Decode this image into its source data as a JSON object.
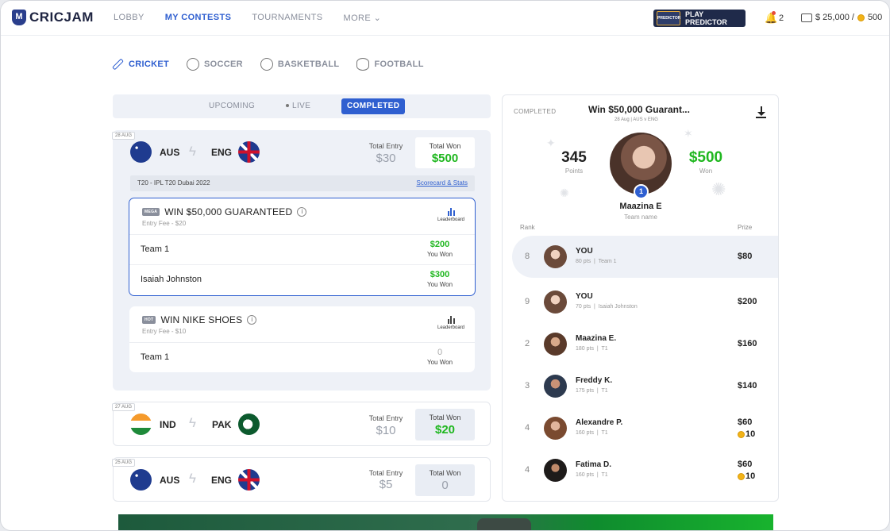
{
  "header": {
    "logo_text": "CRICJAM",
    "nav": [
      "LOBBY",
      "MY CONTESTS",
      "TOURNAMENTS",
      "MORE"
    ],
    "nav_active_index": 1,
    "predictor_label": "PLAY PREDICTOR",
    "notifications": "2",
    "wallet": "$ 25,000 /",
    "coins": "500"
  },
  "sports": [
    "CRICKET",
    "SOCCER",
    "BASKETBALL",
    "FOOTBALL"
  ],
  "tabs": {
    "upcoming": "UPCOMING",
    "live": "LIVE",
    "completed": "COMPLETED"
  },
  "matches": [
    {
      "date": "28 AUG",
      "team1": "AUS",
      "team2": "ENG",
      "entry_label": "Total Entry",
      "entry": "$30",
      "won_label": "Total Won",
      "won": "$500",
      "series": "T20 - IPL T20 Dubai 2022",
      "scorecard": "Scorecard & Stats",
      "contests": [
        {
          "badge": "MEGA",
          "title": "WIN $50,000 GUARANTEED",
          "fee": "Entry Fee - $20",
          "leaderboard": "Leaderboard",
          "rows": [
            {
              "name": "Team 1",
              "amount": "$200",
              "label": "You Won"
            },
            {
              "name": "Isaiah Johnston",
              "amount": "$300",
              "label": "You Won"
            }
          ]
        },
        {
          "badge": "HOT",
          "title": "WIN NIKE SHOES",
          "fee": "Entry Fee - $10",
          "leaderboard": "Leaderboard",
          "rows": [
            {
              "name": "Team 1",
              "amount": "0",
              "label": "You Won"
            }
          ]
        }
      ]
    },
    {
      "date": "27 AUG",
      "team1": "IND",
      "team2": "PAK",
      "entry_label": "Total Entry",
      "entry": "$10",
      "won_label": "Total Won",
      "won": "$20"
    },
    {
      "date": "25 AUG",
      "team1": "AUS",
      "team2": "ENG",
      "entry_label": "Total Entry",
      "entry": "$5",
      "won_label": "Total Won",
      "won": "0"
    }
  ],
  "panel": {
    "status": "COMPLETED",
    "title": "Win $50,000 Guarant...",
    "subtitle": "28 Aug  |  AUS v ENG",
    "points": "345",
    "points_label": "Points",
    "won": "$500",
    "won_label": "Won",
    "rank_badge": "1",
    "user_name": "Maazina E",
    "team_label": "Team name",
    "rank_header": "Rank",
    "prize_header": "Prize",
    "rows": [
      {
        "rank": "8",
        "name": "YOU",
        "pts": "80 pts",
        "team": "Team 1",
        "prize": "$80"
      },
      {
        "rank": "9",
        "name": "YOU",
        "pts": "70 pts",
        "team": "Isaiah Johnston",
        "prize": "$200"
      },
      {
        "rank": "2",
        "name": "Maazina E.",
        "pts": "180 pts",
        "team": "T1",
        "prize": "$160"
      },
      {
        "rank": "3",
        "name": "Freddy K.",
        "pts": "175 pts",
        "team": "T1",
        "prize": "$140"
      },
      {
        "rank": "4",
        "name": "Alexandre P.",
        "pts": "160 pts",
        "team": "T1",
        "prize": "$60",
        "coins": "10"
      },
      {
        "rank": "4",
        "name": "Fatima D.",
        "pts": "160 pts",
        "team": "T1",
        "prize": "$60",
        "coins": "10"
      }
    ]
  },
  "colors": {
    "accent": "#2f5fd0",
    "win_green": "#1fb71f",
    "bg_soft": "#eef1f7"
  }
}
